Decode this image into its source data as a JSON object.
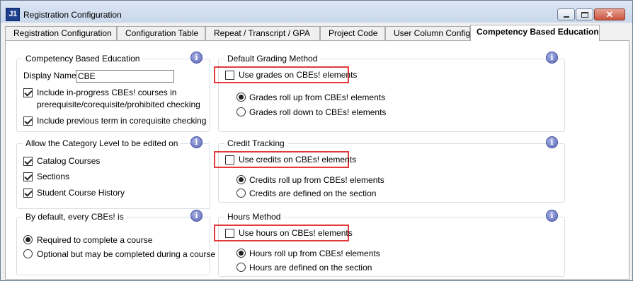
{
  "window": {
    "title": "Registration Configuration",
    "app_icon_text": "J1",
    "close_glyph": "✕"
  },
  "tabs": [
    {
      "label": "Registration Configuration"
    },
    {
      "label": "Configuration Table"
    },
    {
      "label": "Repeat / Transcript / GPA"
    },
    {
      "label": "Project Code"
    },
    {
      "label": "User Column Config"
    },
    {
      "label": "Competency Based Education",
      "active": true
    }
  ],
  "cbe": {
    "title": "Competency Based Education",
    "display_name_label": "Display Name:",
    "display_name_value": "CBE",
    "include_inprogress_line1": "Include in-progress CBEs! courses in",
    "include_inprogress_line2": "prerequisite/corequisite/prohibited checking",
    "include_inprogress_checked": true,
    "include_previous_term": "Include previous term in corequisite checking",
    "include_previous_term_checked": true
  },
  "category_level": {
    "title": "Allow the Category Level to be edited on",
    "items": [
      {
        "label": "Catalog Courses",
        "checked": true
      },
      {
        "label": "Sections",
        "checked": true
      },
      {
        "label": "Student Course History",
        "checked": true
      }
    ]
  },
  "default_cbe": {
    "title": "By default, every CBEs! is",
    "options": [
      {
        "label": "Required to complete a course",
        "selected": true
      },
      {
        "label": "Optional but may be completed during a course",
        "selected": false
      }
    ]
  },
  "grading": {
    "title": "Default Grading Method",
    "checkbox_label": "Use grades on CBEs! elements",
    "checkbox_checked": false,
    "options": [
      {
        "label": "Grades roll up from CBEs! elements",
        "selected": true
      },
      {
        "label": "Grades roll down to CBEs! elements",
        "selected": false
      }
    ]
  },
  "credit": {
    "title": "Credit Tracking",
    "checkbox_label": "Use credits on CBEs! elements",
    "checkbox_checked": false,
    "options": [
      {
        "label": "Credits roll up from CBEs! elements",
        "selected": true
      },
      {
        "label": "Credits are defined on the section",
        "selected": false
      }
    ]
  },
  "hours": {
    "title": "Hours Method",
    "checkbox_label": "Use hours on CBEs! elements",
    "checkbox_checked": false,
    "options": [
      {
        "label": "Hours roll up from CBEs! elements",
        "selected": true
      },
      {
        "label": "Hours are defined on the section",
        "selected": false
      }
    ]
  },
  "info_glyph": "i",
  "colors": {
    "highlight": "#e23a3a",
    "info": "#5b67b8",
    "titlebar": "#c9d8ec"
  }
}
